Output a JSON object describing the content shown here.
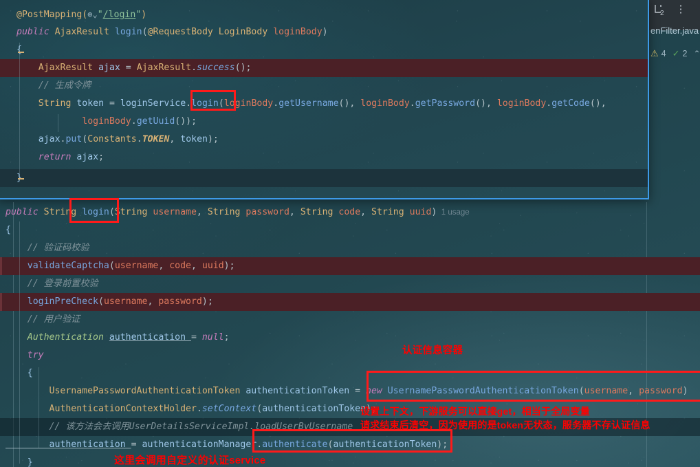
{
  "background_editor": {
    "tab_label": "enFilter.java",
    "split_icon": "split-window-icon",
    "more_icon": "⋮",
    "inspections": {
      "warning_icon": "⚠",
      "warning_count": "4",
      "check_icon": "✓",
      "check_count": "2",
      "chevron": "⌃"
    }
  },
  "popup_panel": {
    "border_color": "#3d9ae8",
    "lines": [
      {
        "id": "postmapping",
        "tokens": [
          {
            "t": "@PostMapping(",
            "c": "ann"
          },
          {
            "t": "⊕",
            "c": "globe"
          },
          {
            "t": "⌄",
            "c": "globe"
          },
          {
            "t": "\"",
            "c": "str"
          },
          {
            "t": "/login",
            "c": "strl"
          },
          {
            "t": "\"",
            "c": "str"
          },
          {
            "t": ")",
            "c": "ann"
          }
        ]
      },
      {
        "id": "method-signature",
        "tokens": [
          {
            "t": "public ",
            "c": "k"
          },
          {
            "t": "AjaxResult ",
            "c": "type"
          },
          {
            "t": "login",
            "c": "mth"
          },
          {
            "t": "(",
            "c": "punc"
          },
          {
            "t": "@RequestBody ",
            "c": "ann"
          },
          {
            "t": "LoginBody ",
            "c": "type"
          },
          {
            "t": "loginBody",
            "c": "par"
          },
          {
            "t": ")",
            "c": "punc"
          }
        ]
      },
      {
        "id": "open-brace",
        "tokens": [
          {
            "t": "{",
            "c": "brace"
          }
        ]
      },
      {
        "id": "ajax-assign",
        "tokens": [
          {
            "t": "    AjaxResult ",
            "c": "type"
          },
          {
            "t": "ajax ",
            "c": "var"
          },
          {
            "t": "= ",
            "c": "punc"
          },
          {
            "t": "AjaxResult",
            "c": "type"
          },
          {
            "t": ".",
            "c": "punc"
          },
          {
            "t": "success",
            "c": "mthi"
          },
          {
            "t": "();",
            "c": "punc"
          }
        ]
      },
      {
        "id": "comment-token",
        "tokens": [
          {
            "t": "    // 生成令牌",
            "c": "cmt"
          }
        ]
      },
      {
        "id": "token-assign",
        "tokens": [
          {
            "t": "    String ",
            "c": "type"
          },
          {
            "t": "token ",
            "c": "var"
          },
          {
            "t": "= ",
            "c": "punc"
          },
          {
            "t": "loginService",
            "c": "var"
          },
          {
            "t": ".",
            "c": "punc"
          },
          {
            "t": "login",
            "c": "mth"
          },
          {
            "t": "(",
            "c": "punc"
          },
          {
            "t": "loginBody",
            "c": "par"
          },
          {
            "t": ".",
            "c": "punc"
          },
          {
            "t": "getUsername",
            "c": "mth"
          },
          {
            "t": "(), ",
            "c": "punc"
          },
          {
            "t": "loginBody",
            "c": "par"
          },
          {
            "t": ".",
            "c": "punc"
          },
          {
            "t": "getPassword",
            "c": "mth"
          },
          {
            "t": "(), ",
            "c": "punc"
          },
          {
            "t": "loginBody",
            "c": "par"
          },
          {
            "t": ".",
            "c": "punc"
          },
          {
            "t": "getCode",
            "c": "mth"
          },
          {
            "t": "(),",
            "c": "punc"
          }
        ]
      },
      {
        "id": "token-assign-cont",
        "tokens": [
          {
            "t": "            loginBody",
            "c": "par"
          },
          {
            "t": ".",
            "c": "punc"
          },
          {
            "t": "getUuid",
            "c": "mth"
          },
          {
            "t": "());",
            "c": "punc"
          }
        ]
      },
      {
        "id": "ajax-put",
        "tokens": [
          {
            "t": "    ajax",
            "c": "var"
          },
          {
            "t": ".",
            "c": "punc"
          },
          {
            "t": "put",
            "c": "mth"
          },
          {
            "t": "(",
            "c": "punc"
          },
          {
            "t": "Constants",
            "c": "type"
          },
          {
            "t": ".",
            "c": "punc"
          },
          {
            "t": "TOKEN",
            "c": "fld"
          },
          {
            "t": ", ",
            "c": "punc"
          },
          {
            "t": "token",
            "c": "var"
          },
          {
            "t": ");",
            "c": "punc"
          }
        ]
      },
      {
        "id": "return-ajax",
        "tokens": [
          {
            "t": "    return ",
            "c": "k"
          },
          {
            "t": "ajax",
            "c": "var"
          },
          {
            "t": ";",
            "c": "punc"
          }
        ]
      },
      {
        "id": "close-brace",
        "tokens": [
          {
            "t": "}",
            "c": "brace"
          }
        ]
      }
    ]
  },
  "lower_editor": {
    "usage_hint": "1 usage",
    "lines": [
      {
        "id": "login-signature",
        "tokens": [
          {
            "t": "public ",
            "c": "k"
          },
          {
            "t": "String ",
            "c": "type"
          },
          {
            "t": "login",
            "c": "mth"
          },
          {
            "t": "(",
            "c": "punc"
          },
          {
            "t": "String ",
            "c": "type"
          },
          {
            "t": "username",
            "c": "par"
          },
          {
            "t": ", ",
            "c": "punc"
          },
          {
            "t": "String ",
            "c": "type"
          },
          {
            "t": "password",
            "c": "par"
          },
          {
            "t": ", ",
            "c": "punc"
          },
          {
            "t": "String ",
            "c": "type"
          },
          {
            "t": "code",
            "c": "par"
          },
          {
            "t": ", ",
            "c": "punc"
          },
          {
            "t": "String ",
            "c": "type"
          },
          {
            "t": "uuid",
            "c": "par"
          },
          {
            "t": ")",
            "c": "punc"
          }
        ]
      },
      {
        "id": "open-brace-2",
        "tokens": [
          {
            "t": "{",
            "c": "brace"
          }
        ]
      },
      {
        "id": "comment-captcha",
        "tokens": [
          {
            "t": "    // 验证码校验",
            "c": "cmt"
          }
        ]
      },
      {
        "id": "validate-captcha",
        "tokens": [
          {
            "t": "    validateCaptcha",
            "c": "mth"
          },
          {
            "t": "(",
            "c": "punc"
          },
          {
            "t": "username",
            "c": "par"
          },
          {
            "t": ", ",
            "c": "punc"
          },
          {
            "t": "code",
            "c": "par"
          },
          {
            "t": ", ",
            "c": "punc"
          },
          {
            "t": "uuid",
            "c": "par"
          },
          {
            "t": ");",
            "c": "punc"
          }
        ]
      },
      {
        "id": "comment-precheck",
        "tokens": [
          {
            "t": "    // 登录前置校验",
            "c": "cmt"
          }
        ]
      },
      {
        "id": "login-precheck",
        "tokens": [
          {
            "t": "    loginPreCheck",
            "c": "mth"
          },
          {
            "t": "(",
            "c": "punc"
          },
          {
            "t": "username",
            "c": "par"
          },
          {
            "t": ", ",
            "c": "punc"
          },
          {
            "t": "password",
            "c": "par"
          },
          {
            "t": ");",
            "c": "punc"
          }
        ]
      },
      {
        "id": "comment-userauth",
        "tokens": [
          {
            "t": "    // 用户验证",
            "c": "cmt"
          }
        ]
      },
      {
        "id": "authentication-null",
        "tokens": [
          {
            "t": "    Authentication ",
            "c": "typei"
          },
          {
            "t": "authentication ",
            "c": "var und"
          },
          {
            "t": "= ",
            "c": "punc"
          },
          {
            "t": "null",
            "c": "k"
          },
          {
            "t": ";",
            "c": "punc"
          }
        ]
      },
      {
        "id": "try-keyword",
        "tokens": [
          {
            "t": "    try",
            "c": "k"
          }
        ]
      },
      {
        "id": "open-brace-3",
        "tokens": [
          {
            "t": "    {",
            "c": "brace"
          }
        ]
      },
      {
        "id": "auth-token-decl",
        "tokens": [
          {
            "t": "        UsernamePasswordAuthenticationToken ",
            "c": "type"
          },
          {
            "t": "authenticationToken ",
            "c": "var"
          },
          {
            "t": "= ",
            "c": "punc"
          },
          {
            "t": "new ",
            "c": "k"
          },
          {
            "t": "UsernamePasswordAuthenticationToken",
            "c": "mth"
          },
          {
            "t": "(",
            "c": "punc"
          },
          {
            "t": "username",
            "c": "par"
          },
          {
            "t": ", ",
            "c": "punc"
          },
          {
            "t": "password",
            "c": "par"
          },
          {
            "t": ")",
            "c": "punc"
          }
        ]
      },
      {
        "id": "set-context",
        "tokens": [
          {
            "t": "        AuthenticationContextHolder",
            "c": "type"
          },
          {
            "t": ".",
            "c": "punc"
          },
          {
            "t": "setContext",
            "c": "mthi"
          },
          {
            "t": "(",
            "c": "punc"
          },
          {
            "t": "authenticationToken",
            "c": "var"
          },
          {
            "t": ");",
            "c": "punc"
          }
        ]
      },
      {
        "id": "comment-loaduser",
        "tokens": [
          {
            "t": "        // 该方法会去调用UserDetailsServiceImpl.loadUserByUsername",
            "c": "cmt"
          }
        ]
      },
      {
        "id": "authenticate-call",
        "tokens": [
          {
            "t": "        authentication ",
            "c": "var und"
          },
          {
            "t": "= ",
            "c": "punc"
          },
          {
            "t": "authenticationManager",
            "c": "var"
          },
          {
            "t": ".",
            "c": "punc"
          },
          {
            "t": "authenticate",
            "c": "mth"
          },
          {
            "t": "(",
            "c": "punc"
          },
          {
            "t": "authenticationToken",
            "c": "var"
          },
          {
            "t": ");",
            "c": "punc"
          }
        ]
      },
      {
        "id": "close-brace-3",
        "tokens": [
          {
            "t": "    }",
            "c": "brace"
          }
        ]
      }
    ]
  },
  "annotations": {
    "color": "#ff0000",
    "label_auth_container": "认证信息容器",
    "label_context_line1": "设置上下文，下游服务可以直接get，相当于全局变量",
    "label_context_line2": "请求结束后清空，因为使用的是token无状态，服务器不存认证信息",
    "label_custom_service": "这里会调用自定义的认证service"
  }
}
